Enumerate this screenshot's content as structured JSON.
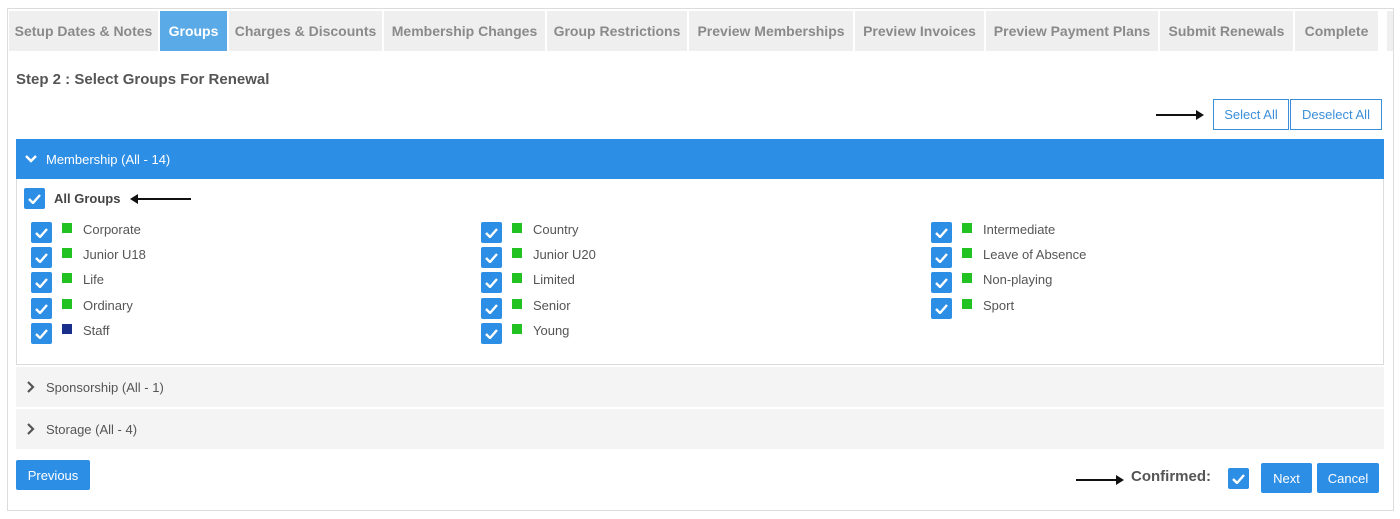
{
  "tabs": [
    {
      "label": "Setup Dates & Notes",
      "active": false
    },
    {
      "label": "Groups",
      "active": true
    },
    {
      "label": "Charges & Discounts",
      "active": false
    },
    {
      "label": "Membership Changes",
      "active": false
    },
    {
      "label": "Group Restrictions",
      "active": false
    },
    {
      "label": "Preview Memberships",
      "active": false
    },
    {
      "label": "Preview Invoices",
      "active": false
    },
    {
      "label": "Preview Payment Plans",
      "active": false
    },
    {
      "label": "Submit Renewals",
      "active": false
    },
    {
      "label": "Complete",
      "active": false
    }
  ],
  "step_title": "Step 2 : Select Groups For Renewal",
  "toolbar": {
    "select_all": "Select All",
    "deselect_all": "Deselect All"
  },
  "panels": [
    {
      "label": "Membership (All - 14)",
      "expanded": true
    },
    {
      "label": "Sponsorship (All - 1)",
      "expanded": false
    },
    {
      "label": "Storage (All - 4)",
      "expanded": false
    }
  ],
  "all_groups_label": "All Groups",
  "colors": {
    "accent": "#2d8ee6",
    "green": "#22c222",
    "navy": "#1a2e8c"
  },
  "groups": [
    {
      "name": "Corporate",
      "color": "#22c222",
      "checked": true
    },
    {
      "name": "Country",
      "color": "#22c222",
      "checked": true
    },
    {
      "name": "Intermediate",
      "color": "#22c222",
      "checked": true
    },
    {
      "name": "Junior U18",
      "color": "#22c222",
      "checked": true
    },
    {
      "name": "Junior U20",
      "color": "#22c222",
      "checked": true
    },
    {
      "name": "Leave of Absence",
      "color": "#22c222",
      "checked": true
    },
    {
      "name": "Life",
      "color": "#22c222",
      "checked": true
    },
    {
      "name": "Limited",
      "color": "#22c222",
      "checked": true
    },
    {
      "name": "Non-playing",
      "color": "#22c222",
      "checked": true
    },
    {
      "name": "Ordinary",
      "color": "#22c222",
      "checked": true
    },
    {
      "name": "Senior",
      "color": "#22c222",
      "checked": true
    },
    {
      "name": "Sport",
      "color": "#22c222",
      "checked": true
    },
    {
      "name": "Staff",
      "color": "#1a2e8c",
      "checked": true
    },
    {
      "name": "Young",
      "color": "#22c222",
      "checked": true
    }
  ],
  "footer": {
    "previous": "Previous",
    "confirmed_label": "Confirmed:",
    "next": "Next",
    "cancel": "Cancel"
  }
}
